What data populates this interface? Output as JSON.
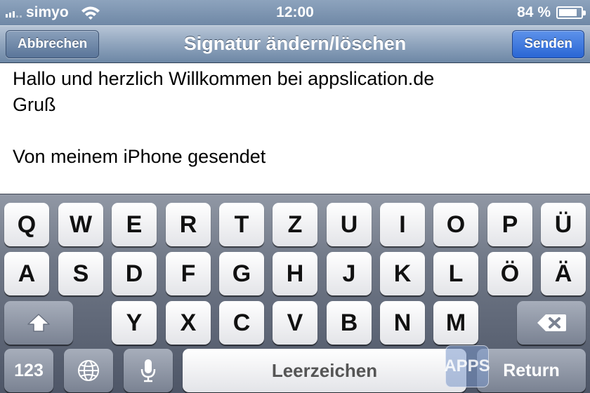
{
  "status_bar": {
    "carrier": "simyo",
    "time": "12:00",
    "battery": "84 %",
    "battery_level": 0.84
  },
  "nav": {
    "cancel_label": "Abbrechen",
    "title": "Signatur ändern/löschen",
    "send_label": "Senden"
  },
  "editor": {
    "lines": [
      "Hallo und herzlich Willkommen bei appslication.de",
      "Gruß",
      "",
      "Von meinem iPhone gesendet"
    ]
  },
  "keyboard": {
    "row1": [
      "Q",
      "W",
      "E",
      "R",
      "T",
      "Z",
      "U",
      "I",
      "O",
      "P",
      "Ü"
    ],
    "row2": [
      "A",
      "S",
      "D",
      "F",
      "G",
      "H",
      "J",
      "K",
      "L",
      "Ö",
      "Ä"
    ],
    "row3": [
      "Y",
      "X",
      "C",
      "V",
      "B",
      "N",
      "M"
    ],
    "numbers_label": "123",
    "space_label": "Leerzeichen",
    "return_label": "Return",
    "shift_icon": "shift-arrow-icon",
    "delete_icon": "backspace-icon",
    "globe_icon": "globe-icon",
    "mic_icon": "microphone-icon"
  },
  "watermark": {
    "text": "APPS"
  }
}
